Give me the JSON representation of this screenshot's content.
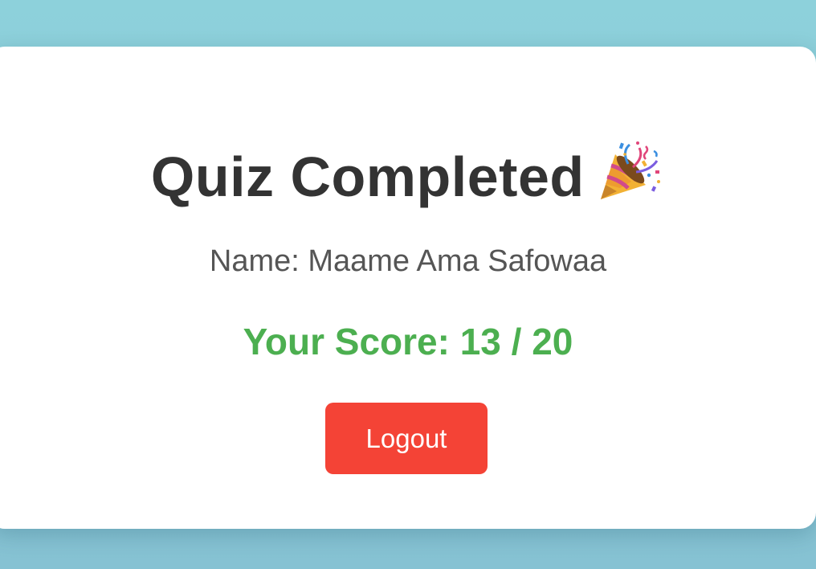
{
  "result": {
    "title": "Quiz Completed",
    "title_icon": "party-popper-icon",
    "name_line": "Name: Maame Ama Safowaa",
    "score_line": "Your Score: 13 / 20",
    "score": 13,
    "score_total": 20,
    "logout_label": "Logout"
  },
  "colors": {
    "background": "#8dd1db",
    "card": "#ffffff",
    "title_text": "#333333",
    "name_text": "#555555",
    "score_text": "#4caf50",
    "logout_button": "#f44336",
    "logout_text": "#ffffff"
  }
}
